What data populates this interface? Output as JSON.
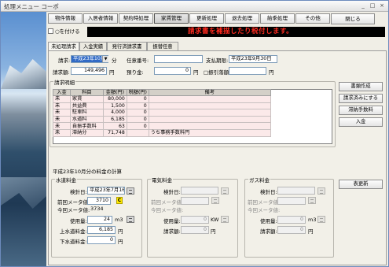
{
  "window": {
    "title": "処理メニュー コーポ"
  },
  "menu": {
    "items": [
      "物件情報",
      "入居者情報",
      "契約時処理",
      "家賃管理",
      "更新処理",
      "退去処理",
      "給季処理",
      "その他"
    ],
    "active_index": 3,
    "close_label": "閉じる"
  },
  "option": {
    "checkbox_label": "○を付ける"
  },
  "banner": {
    "text": "請求書を補描したり税付します。"
  },
  "tabs": [
    "未処理請求",
    "入金実績",
    "発行済請求書",
    "振替任意"
  ],
  "request": {
    "month_label": "請求:",
    "month_value": "平成23年10月",
    "month_unit": "分",
    "number_label": "任意番号:",
    "due_label": "支払期限:",
    "due_value": "平成23年9月30日",
    "amount_label": "請求額:",
    "amount_value": "149,496",
    "amount_unit": "円",
    "deposit_label": "預り金:",
    "deposit_value": "0",
    "deposit_unit": "円",
    "transfer_label": "□振引落額:",
    "transfer_value": "円"
  },
  "detail": {
    "group_title": "請求明細",
    "columns": [
      "入金",
      "科目",
      "金額(円)",
      "税額(円)",
      "備考"
    ],
    "rows": [
      [
        "未",
        "家賃",
        "80,000",
        "0",
        ""
      ],
      [
        "未",
        "共益費",
        "1,500",
        "0",
        ""
      ],
      [
        "未",
        "駐車料",
        "4,000",
        "0",
        ""
      ],
      [
        "未",
        "水道料",
        "6,185",
        "0",
        ""
      ],
      [
        "未",
        "自振手数料",
        "63",
        "0",
        ""
      ],
      [
        "未",
        "滞納分",
        "71,748",
        "",
        "うち事務手数料円"
      ]
    ]
  },
  "side_buttons": [
    "書類作成",
    "請求済みにする",
    "滞納手数料",
    "入金"
  ],
  "utilities": {
    "section_title": "平成23年10月分の料金の計算",
    "update_button": "表更新",
    "water": {
      "title": "水道料金",
      "check_date_label": "検針日:",
      "check_date_value": "平成23年7月16日",
      "prev_label": "前回メータ値:",
      "prev_value": "3710",
      "badge": "C",
      "curr_label": "今回メータ値:",
      "curr_value": "3734",
      "usage_label": "使用量:",
      "usage_value": "24",
      "usage_unit": "m3",
      "upper_label": "上水道料金:",
      "upper_value": "6,185",
      "upper_unit": "円",
      "lower_label": "下水道料金:",
      "lower_value": "0",
      "lower_unit": "円"
    },
    "electric": {
      "title": "電気料金",
      "check_date_label": "検針日:",
      "prev_label": "前回メータ値:",
      "curr_label": "今回メータ値:",
      "usage_label": "使用量:",
      "usage_value": "0",
      "usage_unit": "KW",
      "bill_label": "請求額:",
      "bill_value": "0",
      "bill_unit": "円"
    },
    "gas": {
      "title": "ガス料金",
      "check_date_label": "検針日:",
      "prev_label": "前回メータ値:",
      "curr_label": "今回メータ値:",
      "usage_label": "使用量:",
      "usage_value": "0",
      "usage_unit": "m3",
      "bill_label": "請求額:",
      "bill_value": "0",
      "bill_unit": "円"
    }
  }
}
